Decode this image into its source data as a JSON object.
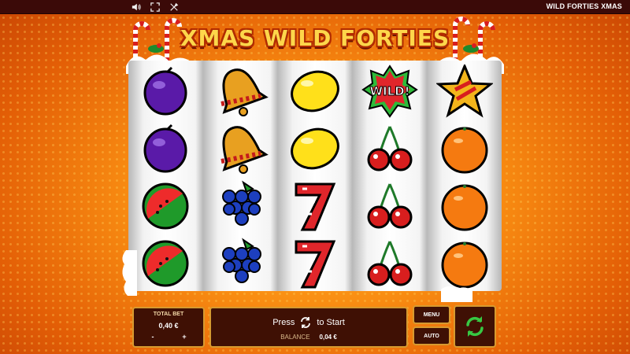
{
  "topbar": {
    "title": "WILD FORTIES XMAS",
    "icons": [
      "speaker-icon",
      "fullscreen-icon",
      "settings-tool-icon"
    ]
  },
  "logo": {
    "text": "XMAS WILD FORTIES"
  },
  "reels": [
    [
      "plum",
      "plum",
      "watermelon",
      "watermelon"
    ],
    [
      "bell",
      "bell",
      "grapes",
      "grapes"
    ],
    [
      "lemon",
      "lemon",
      "seven",
      "seven"
    ],
    [
      "wild",
      "cherries",
      "cherries",
      "cherries"
    ],
    [
      "star",
      "orange",
      "orange",
      "orange"
    ]
  ],
  "wild_text": "WILD!",
  "bottom": {
    "total_bet_label": "TOTAL BET",
    "total_bet_value": "0,40 €",
    "minus": "-",
    "plus": "+",
    "press_text": "Press",
    "to_start_text": "to Start",
    "balance_label": "BALANCE",
    "balance_value": "0,04 €",
    "menu_label": "MENU",
    "auto_label": "AUTO"
  },
  "colors": {
    "panel_bg": "#3f1004",
    "panel_border": "#d79a2f",
    "spin_icon": "#37c843",
    "topbar_bg": "#3b0a08"
  }
}
